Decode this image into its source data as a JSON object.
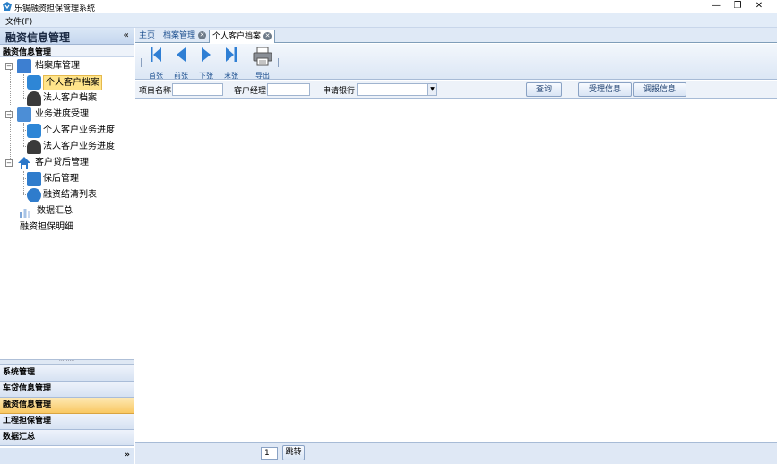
{
  "window": {
    "title": "乐锔融资担保管理系统",
    "minimize": "—",
    "restore": "❐",
    "close": "✕"
  },
  "menubar": {
    "file": "文件(F)"
  },
  "sidebar": {
    "header": "融资信息管理",
    "collapse_glyph": "«",
    "section": "融资信息管理",
    "tree": {
      "archive": "档案库管理",
      "personal_archive": "个人客户档案",
      "corporate_archive": "法人客户档案",
      "progress": "业务进度受理",
      "personal_progress": "个人客户业务进度",
      "corporate_progress": "法人客户业务进度",
      "postloan": "客户贷后管理",
      "guarantee_mgmt": "保后管理",
      "settlement_list": "融资结清列表",
      "data_summary": "数据汇总",
      "guarantee_detail": "融资担保明细"
    },
    "splitter_glyph": "·········",
    "nav": [
      {
        "label": "系统管理"
      },
      {
        "label": "车贷信息管理"
      },
      {
        "label": "融资信息管理"
      },
      {
        "label": "工程担保管理"
      },
      {
        "label": "数据汇总"
      }
    ],
    "footer_glyph": "»"
  },
  "tabs": {
    "home": "主页",
    "archive_mgmt": "档案管理",
    "personal_archive": "个人客户档案",
    "close_glyph": "✕"
  },
  "toolbar": {
    "first": "首张",
    "prev": "前张",
    "next": "下张",
    "last": "末张",
    "export": "导出"
  },
  "filter": {
    "project_name_label": "项目名称",
    "project_name_value": "",
    "manager_label": "客户经理",
    "manager_value": "",
    "bank_label": "申请银行",
    "bank_value": "",
    "select_arrow": "▼",
    "query": "查询",
    "accept_info": "受理信息",
    "survey_info": "调报信息"
  },
  "pager": {
    "page_value": "1",
    "jump": "跳转"
  },
  "colors": {
    "accent": "#1c4f8f",
    "selected": "#ffe48a",
    "active_nav": "#f9c862"
  }
}
